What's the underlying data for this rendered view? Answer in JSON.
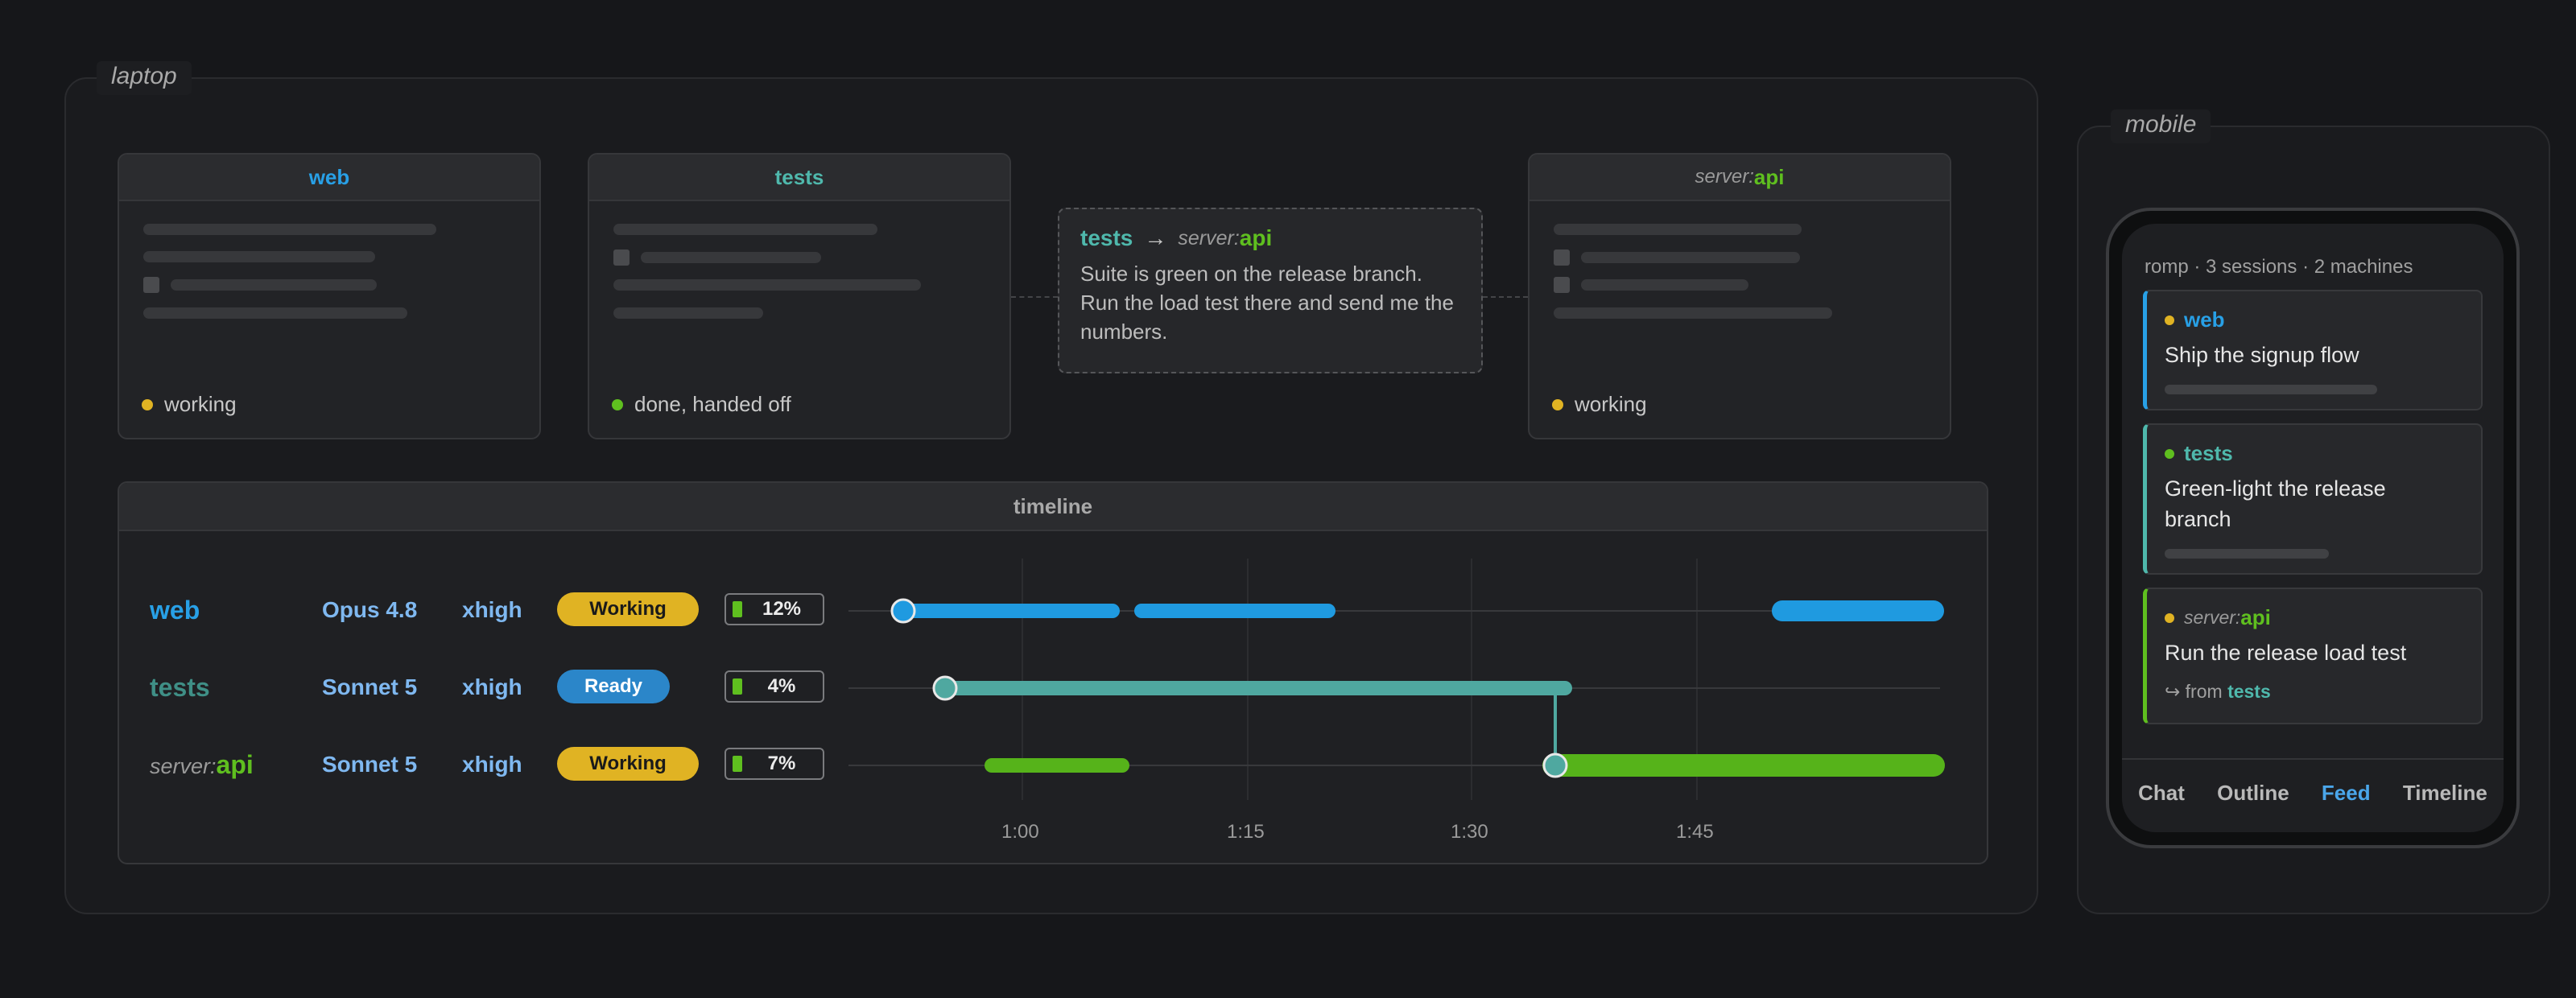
{
  "groups": {
    "laptop": "laptop",
    "mobile": "mobile"
  },
  "sessions": [
    {
      "name": "web",
      "status": "working",
      "status_color": "#e0b323"
    },
    {
      "name": "tests",
      "status": "done, handed off",
      "status_color": "#5fbf1f"
    },
    {
      "host": "server",
      "sep": ":",
      "name": "api",
      "status": "working",
      "status_color": "#e0b323"
    }
  ],
  "handoff": {
    "from": "tests",
    "arrow": "→",
    "to_host": "server",
    "to_sep": ":",
    "to_name": "api",
    "message": "Suite is green on the release branch. Run the load test there and send me the numbers."
  },
  "timeline": {
    "title": "timeline",
    "rows": [
      {
        "name": "web",
        "model": "Opus 4.8",
        "effort": "xhigh",
        "status": "Working",
        "context": "12%",
        "context_fraction": 0.12
      },
      {
        "name": "tests",
        "model": "Sonnet 5",
        "effort": "xhigh",
        "status": "Ready",
        "context": "4%",
        "context_fraction": 0.04
      },
      {
        "host": "server",
        "sep": ":",
        "name": "api",
        "model": "Sonnet 5",
        "effort": "xhigh",
        "status": "Working",
        "context": "7%",
        "context_fraction": 0.07
      }
    ],
    "ticks": [
      "1:00",
      "1:15",
      "1:30",
      "1:45"
    ]
  },
  "mobile": {
    "header": "romp · 3 sessions · 2 machines",
    "cards": [
      {
        "name": "web",
        "task": "Ship the signup flow",
        "dot": "#e0b323"
      },
      {
        "name": "tests",
        "task": "Green-light the release branch",
        "dot": "#5fbf1f"
      },
      {
        "host": "server",
        "sep": ":",
        "name": "api",
        "task": "Run the release load test",
        "from_arrow": "↪",
        "from_label": "from",
        "from_name": "tests",
        "dot": "#e0b323"
      }
    ],
    "tabs": [
      "Chat",
      "Outline",
      "Feed",
      "Timeline"
    ],
    "active_tab": "Feed"
  },
  "colors": {
    "web": "#28a0e6",
    "tests": "#4fb8ac",
    "api": "#5fbf1f",
    "working": "#e0b323",
    "ready": "#2b86c9"
  }
}
